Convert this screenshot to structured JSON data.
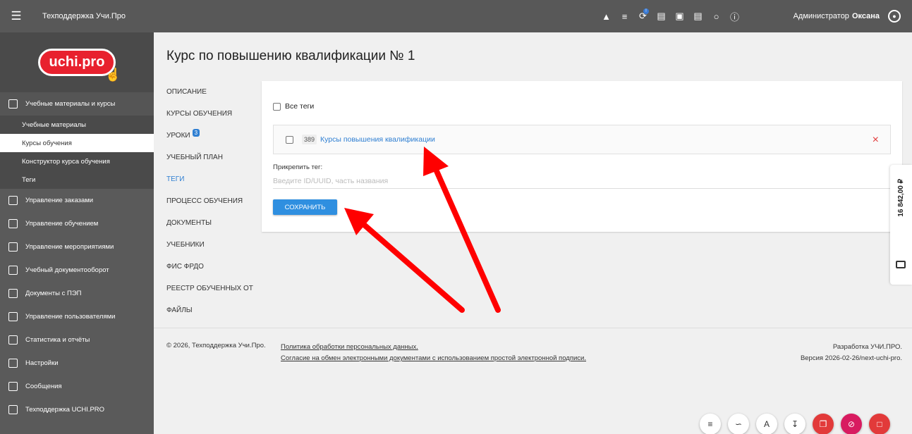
{
  "header": {
    "app_title": "Техподдержка Учи.Про",
    "admin_label": "Администратор",
    "admin_name": "Оксана",
    "notification_badge": "!"
  },
  "logo": {
    "text": "uchi.pro"
  },
  "sidebar": {
    "items": [
      {
        "label": "Учебные материалы и курсы",
        "icon": "book-icon"
      },
      {
        "label": "Управление заказами",
        "icon": "orders-icon"
      },
      {
        "label": "Управление обучением",
        "icon": "learning-icon"
      },
      {
        "label": "Управление мероприятиями",
        "icon": "events-icon"
      },
      {
        "label": "Учебный документооборот",
        "icon": "document-icon"
      },
      {
        "label": "Документы с ПЭП",
        "icon": "signature-icon"
      },
      {
        "label": "Управление пользователями",
        "icon": "users-icon"
      },
      {
        "label": "Статистика и отчёты",
        "icon": "stats-icon"
      },
      {
        "label": "Настройки",
        "icon": "gear-icon"
      },
      {
        "label": "Сообщения",
        "icon": "message-icon"
      },
      {
        "label": "Техподдержка UCHI.PRO",
        "icon": "support-icon"
      }
    ],
    "subitems": [
      {
        "label": "Учебные материалы"
      },
      {
        "label": "Курсы обучения"
      },
      {
        "label": "Конструктор курса обучения"
      },
      {
        "label": "Теги"
      }
    ]
  },
  "page": {
    "title": "Курс по повышению квалификации № 1"
  },
  "tabs": [
    {
      "label": "ОПИСАНИЕ"
    },
    {
      "label": "КУРСЫ ОБУЧЕНИЯ"
    },
    {
      "label": "УРОКИ",
      "badge": "3"
    },
    {
      "label": "УЧЕБНЫЙ ПЛАН"
    },
    {
      "label": "ТЕГИ"
    },
    {
      "label": "ПРОЦЕСС ОБУЧЕНИЯ"
    },
    {
      "label": "ДОКУМЕНТЫ"
    },
    {
      "label": "УЧЕБНИКИ"
    },
    {
      "label": "ФИС ФРДО"
    },
    {
      "label": "РЕЕСТР ОБУЧЕННЫХ ОТ"
    },
    {
      "label": "ФАЙЛЫ"
    }
  ],
  "tags_card": {
    "all_tags_label": "Все теги",
    "tag": {
      "id": "389",
      "name": "Курсы повышения квалификации"
    },
    "remove_icon": "×",
    "attach_label": "Прикрепить тег:",
    "attach_placeholder": "Введите ID/UUID, часть названия",
    "save_label": "СОХРАНИТЬ"
  },
  "balance": {
    "amount": "16 842,00 ₽"
  },
  "footer": {
    "copyright": "© 2026, Техподдержка Учи.Про.",
    "link_privacy": "Политика обработки персональных данных.",
    "link_agreement": "Согласие на обмен электронными документами с использованием простой электронной подписи.",
    "dev": "Разработка УЧИ.ПРО.",
    "version": "Версия 2026-02-26/next-uchi-pro."
  },
  "colors": {
    "accent": "#2f8fe0",
    "danger": "#e23a3a",
    "arrow": "#ff0000",
    "sidebar": "#5a5a5a"
  }
}
